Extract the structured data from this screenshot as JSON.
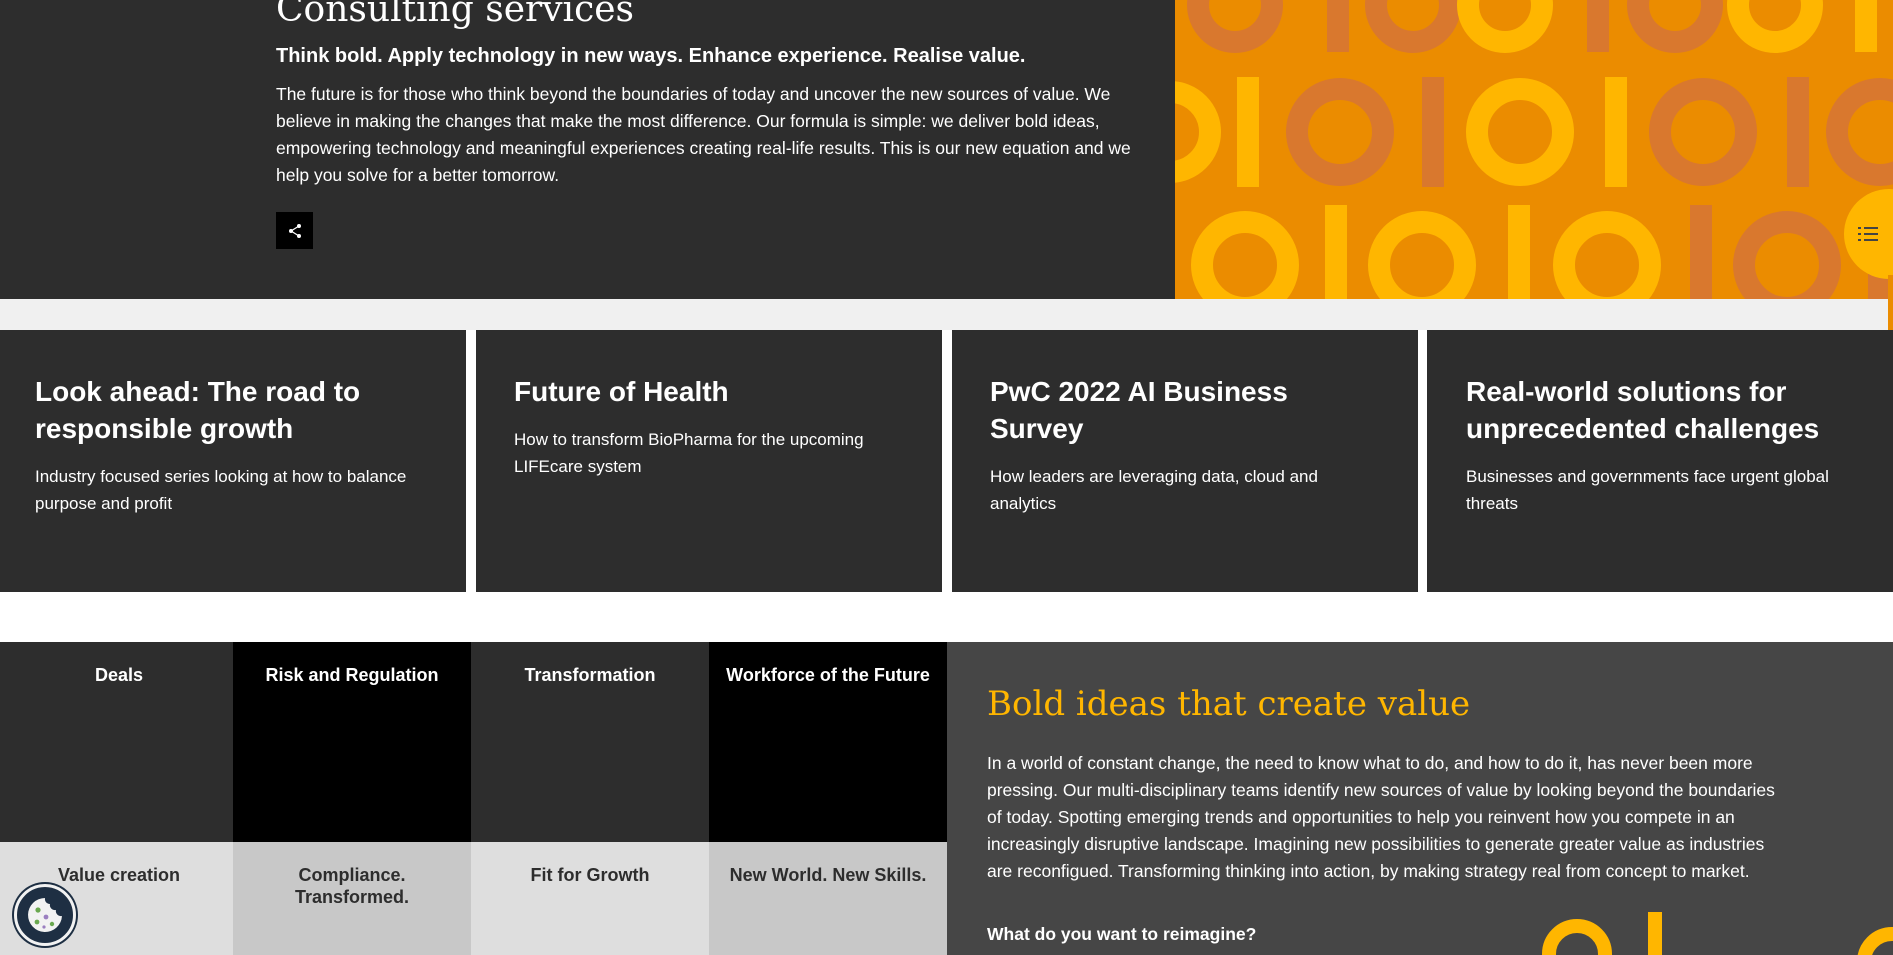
{
  "hero": {
    "title": "Consulting services",
    "subtitle": "Think bold. Apply technology in new ways. Enhance experience. Realise value.",
    "body": "The future is for those who think beyond the boundaries of today and uncover the new sources of value. We believe in making the changes that make the most difference. Our formula is simple: we deliver bold ideas, empowering technology and meaningful experiences creating real-life results. This is our new equation and we help you solve for a better tomorrow.",
    "share_icon": "share-icon",
    "toc_icon": "list-icon",
    "art_colors": {
      "background": "#eb8c00",
      "light": "#ffb600",
      "dark": "#d9782e"
    }
  },
  "cards": [
    {
      "title": "Look ahead: The road to responsible growth",
      "desc": "Industry focused series looking at how to balance purpose and profit"
    },
    {
      "title": "Future of Health",
      "desc": "How to transform BioPharma for the upcoming LIFEcare system"
    },
    {
      "title": "PwC 2022 AI Business Survey",
      "desc": "How leaders are leveraging data, cloud and analytics"
    },
    {
      "title": "Real-world solutions for unprecedented challenges",
      "desc": "Businesses and governments face urgent global threats"
    }
  ],
  "tiles": [
    {
      "heading": "Deals",
      "tagline": "Value creation",
      "top_color": "#2d2d2d",
      "bottom_color": "#dedede"
    },
    {
      "heading": "Risk and Regulation",
      "tagline": "Compliance. Transformed.",
      "top_color": "#000000",
      "bottom_color": "#c8c8c8"
    },
    {
      "heading": "Transformation",
      "tagline": "Fit for Growth",
      "top_color": "#2d2d2d",
      "bottom_color": "#dedede"
    },
    {
      "heading": "Workforce of the Future",
      "tagline": "New World. New Skills.",
      "top_color": "#000000",
      "bottom_color": "#c8c8c8"
    }
  ],
  "bold_ideas": {
    "title": "Bold ideas that create value",
    "body": "In a world of constant change, the need to know what to do, and how to do it, has never been more pressing. Our multi-disciplinary teams identify new sources of value by looking beyond the boundaries of today. Spotting emerging trends and opportunities to help you reinvent how you compete in an increasingly disruptive landscape. Imagining new possibilities to generate greater value as industries are reconfigued. Transforming thinking into action, by making strategy real from concept to market.",
    "question": "What do you want to reimagine?",
    "accent_color": "#ffb600"
  },
  "cookie": {
    "icon": "cookie-icon"
  }
}
